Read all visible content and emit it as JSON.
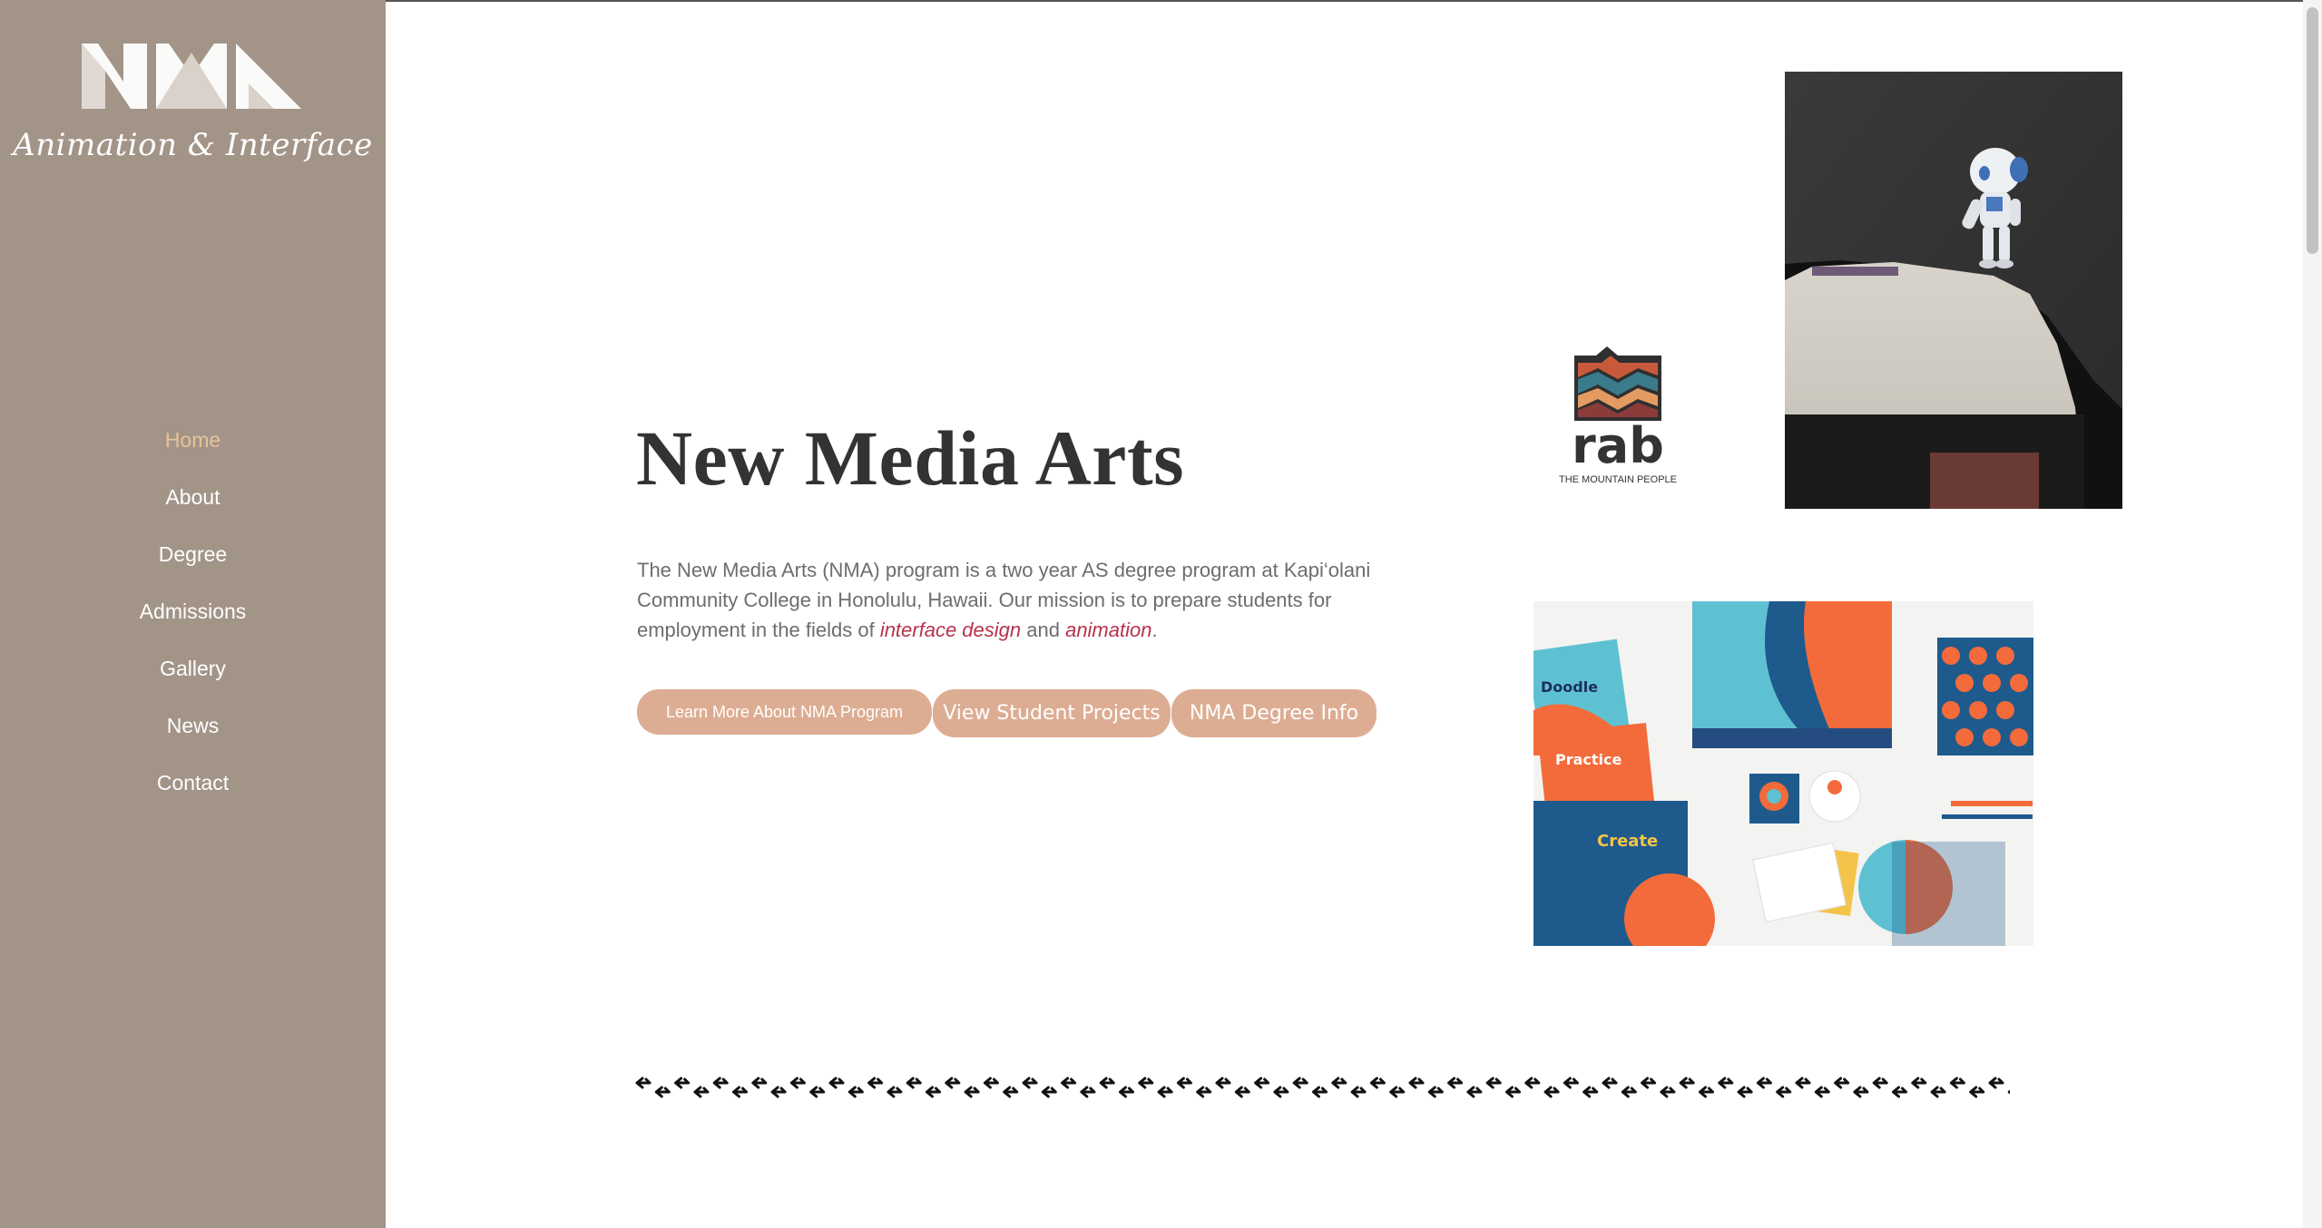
{
  "brand": {
    "logo_name": "NMA logo",
    "tagline": "Animation & Interface"
  },
  "nav": {
    "items": [
      {
        "label": "Home",
        "active": true
      },
      {
        "label": "About"
      },
      {
        "label": "Degree"
      },
      {
        "label": "Admissions"
      },
      {
        "label": "Gallery"
      },
      {
        "label": "News"
      },
      {
        "label": "Contact"
      }
    ]
  },
  "hero": {
    "title": "New Media Arts",
    "intro_before": "The New Media Arts (NMA) program is a two year AS degree program at Kapi‘olani Community College in Honolulu, Hawaii. Our mission is to prepare students for employment in the fields of ",
    "link_interface": "interface design",
    "intro_middle": " and ",
    "link_animation": "animation",
    "intro_after": "."
  },
  "buttons": {
    "learn_more": "Learn More About NMA Program",
    "student_projects": "View Student Projects",
    "degree_info": "NMA Degree Info"
  },
  "gallery_images": {
    "rab_wordmark": "rab",
    "rab_subtitle": "THE MOUNTAIN PEOPLE",
    "brand_doodle": "Doodle",
    "brand_practice": "Practice",
    "brand_create": "Create"
  },
  "colors": {
    "sidebar_bg": "#a39488",
    "nav_active": "#e6c39a",
    "button_bg": "#ddad93",
    "link": "#b8324c",
    "title": "#333333"
  }
}
